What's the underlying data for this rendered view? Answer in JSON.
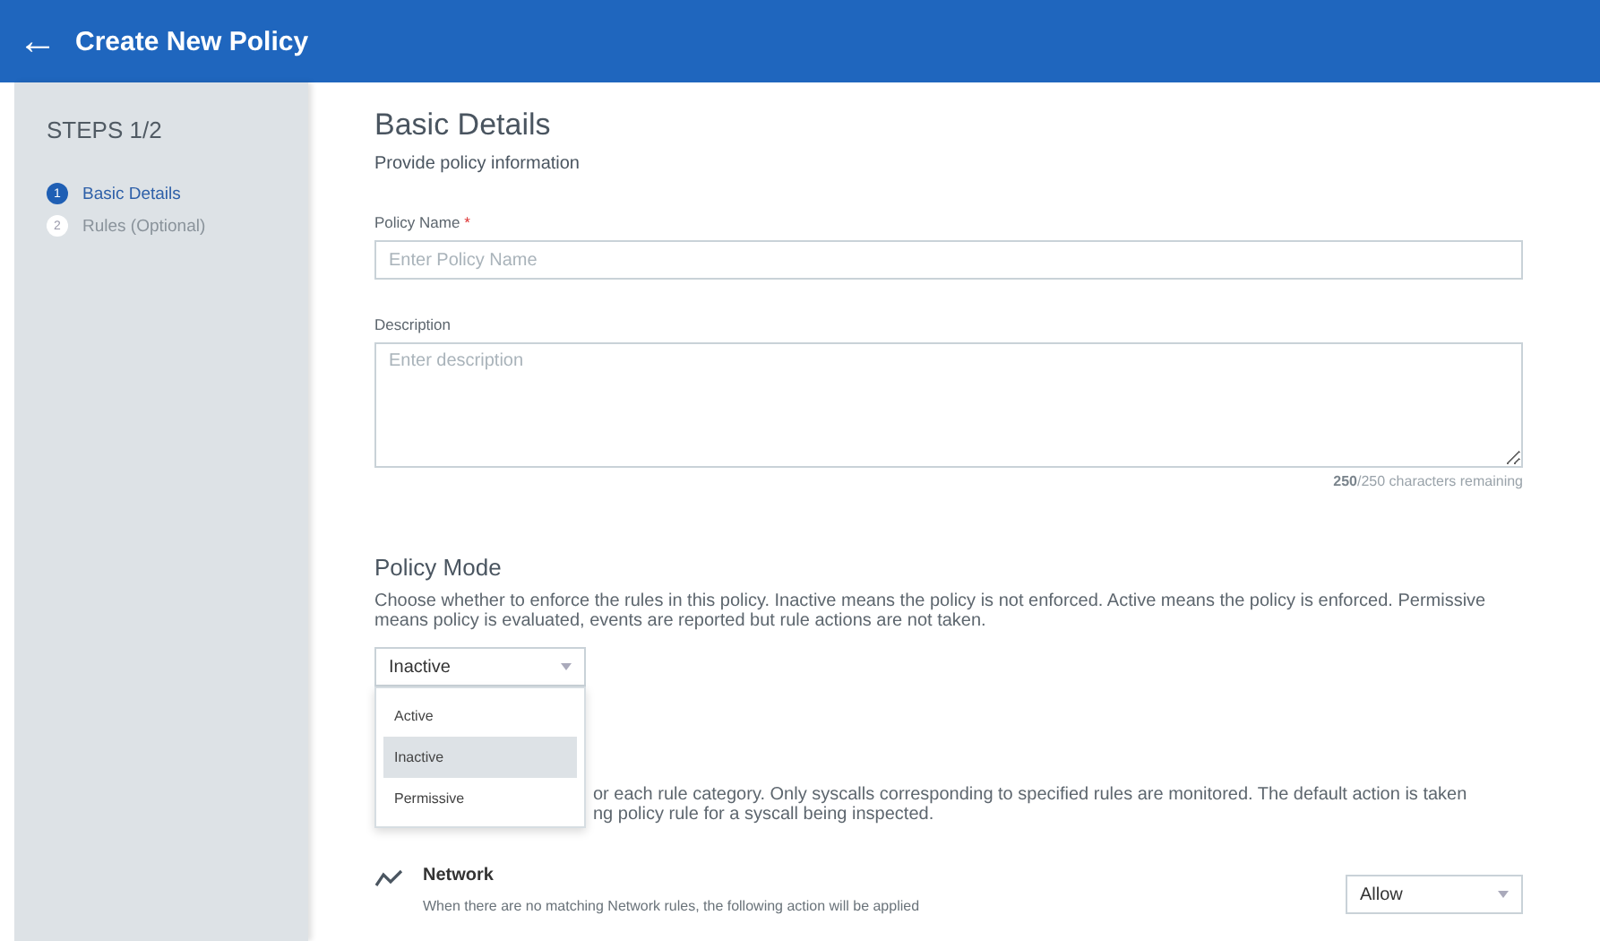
{
  "header": {
    "back_icon": "←",
    "title": "Create New Policy"
  },
  "sidebar": {
    "title": "STEPS 1/2",
    "steps": [
      {
        "number": "1",
        "label": "Basic Details",
        "selected": true
      },
      {
        "number": "2",
        "label": "Rules (Optional)",
        "selected": false
      }
    ]
  },
  "section": {
    "title": "Basic Details",
    "subtitle": "Provide policy information"
  },
  "policy_name": {
    "label": "Policy Name",
    "required_mark": "*",
    "placeholder": "Enter Policy Name"
  },
  "description": {
    "label": "Description",
    "placeholder": "Enter description",
    "counter_bold": "250",
    "counter_rest": "/250 characters remaining"
  },
  "policy_mode": {
    "title": "Policy Mode",
    "text": "Choose whether to enforce the rules in this policy. Inactive means the policy is not enforced. Active means the policy is enforced. Permissive means policy is evaluated, events are reported but rule actions are not taken.",
    "value": "Inactive",
    "expanded": true,
    "options": [
      {
        "label": "Active",
        "selected": false
      },
      {
        "label": "Inactive",
        "selected": true
      },
      {
        "label": "Permissive",
        "selected": false
      }
    ]
  },
  "rules_text": [
    "or each rule category. Only syscalls corresponding to specified rules are monitored. The default action is taken",
    "ng policy rule for a syscall being inspected."
  ],
  "network": {
    "title": "Network",
    "text": "When there are no matching Network rules, the following action will be applied",
    "action": "Allow"
  }
}
